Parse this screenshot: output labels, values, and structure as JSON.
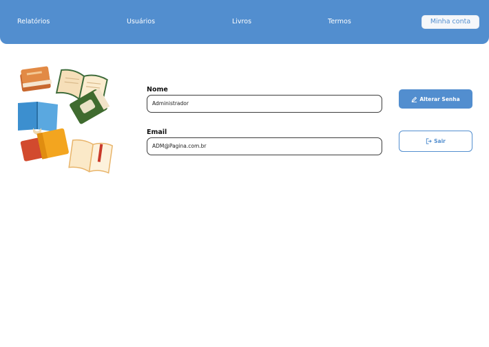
{
  "nav": {
    "items": [
      {
        "label": "Relatórios"
      },
      {
        "label": "Usuários"
      },
      {
        "label": "Livros"
      },
      {
        "label": "Termos"
      }
    ],
    "account_label": "Minha conta"
  },
  "illustration": {
    "icon": "books-illustration"
  },
  "profile": {
    "name_label": "Nome",
    "name_value": "Administrador",
    "email_label": "Email",
    "email_value": "ADM@Pagina.com.br"
  },
  "actions": {
    "change_password_label": "Alterar Senha",
    "change_password_icon": "pencil-icon",
    "logout_label": "Sair",
    "logout_icon": "logout-icon"
  },
  "colors": {
    "brand": "#528ecf",
    "background": "#ffffff",
    "text": "#111111"
  }
}
